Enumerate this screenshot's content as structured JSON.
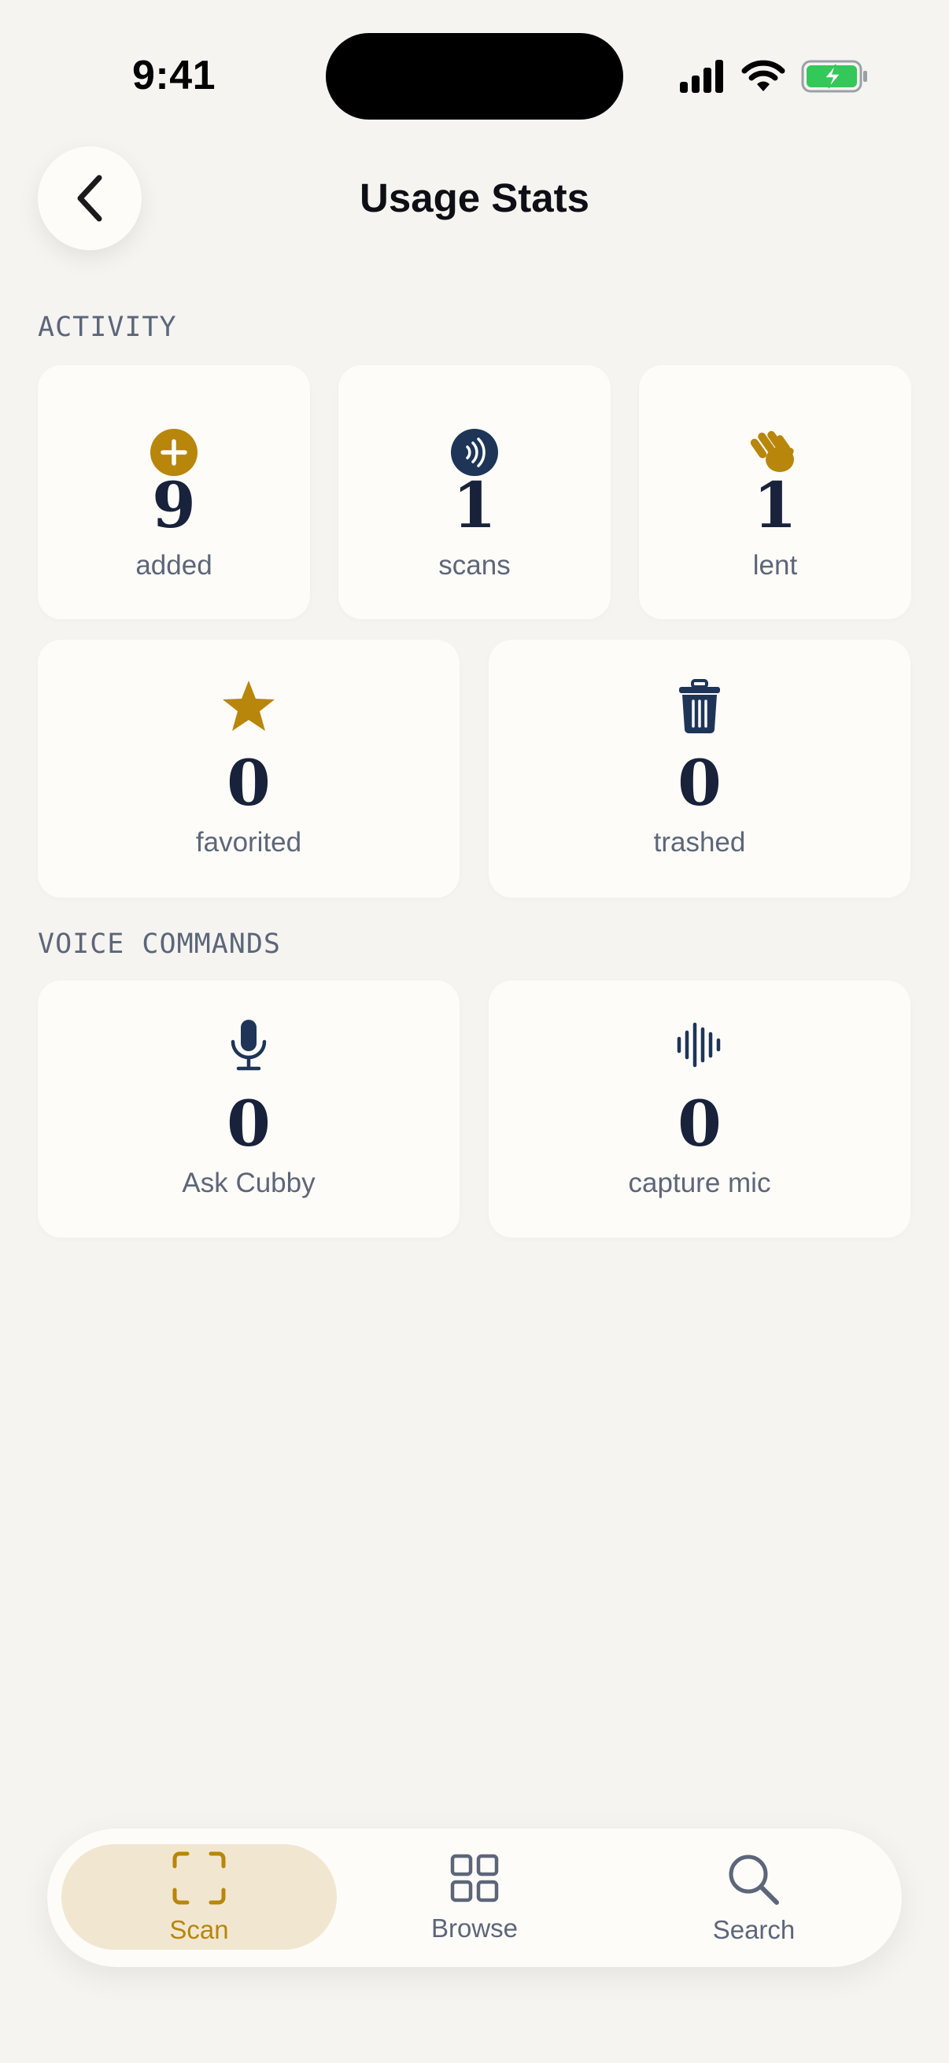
{
  "status_bar": {
    "time": "9:41"
  },
  "header": {
    "title": "Usage Stats"
  },
  "sections": {
    "activity": {
      "label": "ACTIVITY",
      "cards": [
        {
          "value": "9",
          "label": "added",
          "icon": "plus-circle-icon"
        },
        {
          "value": "1",
          "label": "scans",
          "icon": "nfc-scan-icon"
        },
        {
          "value": "1",
          "label": "lent",
          "icon": "hand-wave-icon"
        },
        {
          "value": "0",
          "label": "favorited",
          "icon": "star-icon"
        },
        {
          "value": "0",
          "label": "trashed",
          "icon": "trash-icon"
        }
      ]
    },
    "voice": {
      "label": "VOICE COMMANDS",
      "cards": [
        {
          "value": "0",
          "label": "Ask Cubby",
          "icon": "microphone-icon"
        },
        {
          "value": "0",
          "label": "capture mic",
          "icon": "waveform-icon"
        }
      ]
    }
  },
  "tabbar": {
    "tabs": [
      {
        "label": "Scan",
        "icon": "scan-frame-icon",
        "active": true
      },
      {
        "label": "Browse",
        "icon": "grid-icon",
        "active": false
      },
      {
        "label": "Search",
        "icon": "search-icon",
        "active": false
      }
    ]
  },
  "colors": {
    "background": "#f5f4f1",
    "card": "#fdfcf9",
    "gold": "#b8860b",
    "navy": "#1e3558",
    "muted": "#5d6679",
    "active_pill": "#f1e7d1"
  }
}
